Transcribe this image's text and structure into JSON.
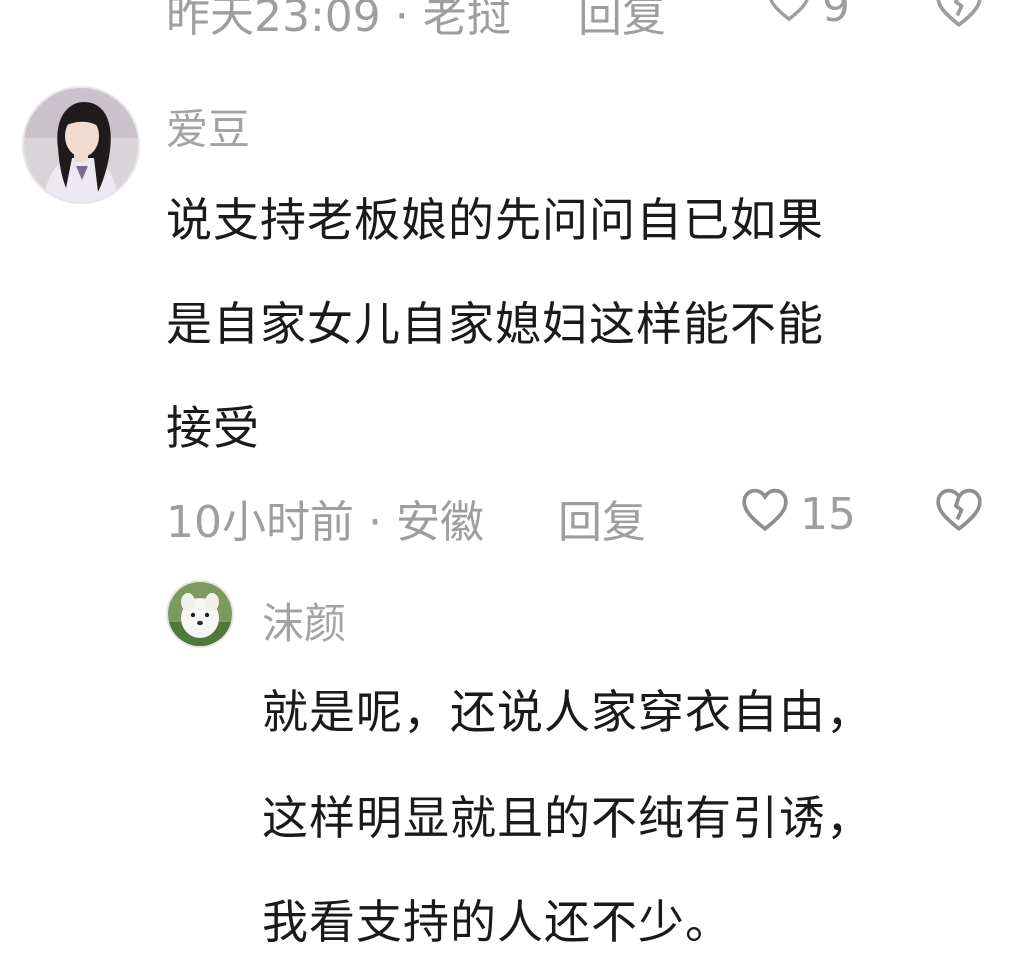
{
  "previous_comment": {
    "meta": "昨天23:09 · 老挝",
    "reply_label": "回复",
    "like_count": "9"
  },
  "comment": {
    "username": "爱豆",
    "lines": [
      "说支持老板娘的先问问自已如果",
      "是自家女儿自家媳妇这样能不能",
      "接受"
    ],
    "meta": "10小时前 · 安徽",
    "reply_label": "回复",
    "like_count": "15"
  },
  "reply": {
    "username": "沫颜",
    "lines": [
      "就是呢，还说人家穿衣自由，",
      "这样明显就且的不纯有引诱，",
      "我看支持的人还不少。"
    ]
  }
}
